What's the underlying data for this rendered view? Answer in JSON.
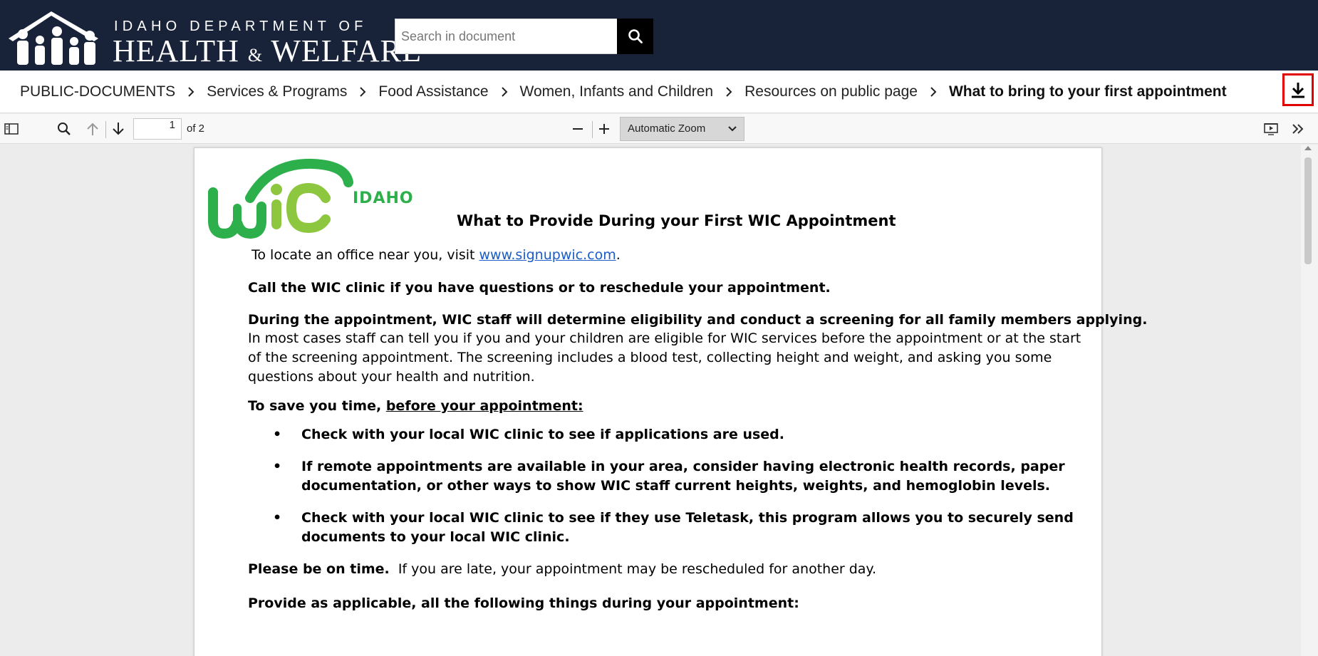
{
  "header": {
    "logo_line1": "IDAHO DEPARTMENT OF",
    "logo_line2_a": "HEALTH",
    "logo_amp": "&",
    "logo_line2_b": "WELFARE",
    "search_placeholder": "Search in document",
    "brand_color": "#18233a"
  },
  "breadcrumb": {
    "items": [
      "PUBLIC-DOCUMENTS",
      "Services & Programs",
      "Food Assistance",
      "Women, Infants and Children",
      "Resources on public page",
      "What to bring to your first appointment"
    ],
    "download_icon": "download-icon",
    "highlight_color": "#e00000"
  },
  "toolbar": {
    "page_value": "1",
    "of_pages": "of 2",
    "zoom": "Automatic Zoom",
    "icons": [
      "sidebar-toggle-icon",
      "search-icon",
      "arrow-up-icon",
      "arrow-down-icon",
      "minus-icon",
      "plus-icon",
      "presentation-icon",
      "double-chevron-right-icon"
    ]
  },
  "document": {
    "logo_text": "IDAHO",
    "title": "What to Provide During your First WIC Appointment",
    "locate_prefix": "To locate an office near you, visit ",
    "locate_link": "www.signupwic.com",
    "locate_suffix": ".",
    "call_line": "Call the WIC clinic if you have questions or to reschedule your appointment.",
    "during_bold": "During the appointment, WIC staff will determine eligibility and conduct a screening for all family members applying.",
    "during_l1": "In most cases staff can tell you if you and your children are eligible for WIC services before the appointment or at the start",
    "during_l2": "of the screening appointment. The screening includes a blood test, collecting height and weight, and asking you some",
    "during_l3": "questions about your health and nutrition.",
    "save_prefix": "To save you time, ",
    "save_underline": "before your appointment:",
    "bullets": [
      {
        "l1": "Check with your local WIC clinic to see if applications are used.",
        "l2": ""
      },
      {
        "l1": "If remote appointments are available in your area, consider having electronic health records, paper",
        "l2": "documentation, or other ways to show WIC staff current heights, weights, and hemoglobin levels."
      },
      {
        "l1": "Check with your local WIC clinic to see if they use Teletask, this program allows you to securely send",
        "l2": "documents to your local WIC clinic."
      }
    ],
    "bullet_char": "•",
    "ontime_bold": "Please be on time.",
    "ontime_rest": "  If you are late, your appointment may be rescheduled for another day.",
    "provide_line": "Provide as applicable, all the following things during your appointment:"
  }
}
